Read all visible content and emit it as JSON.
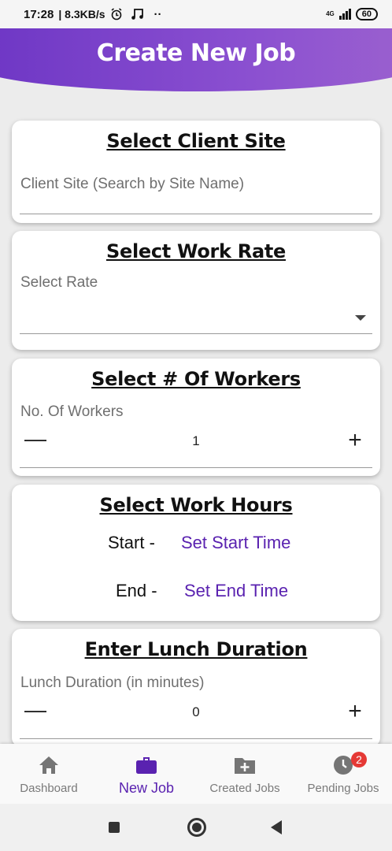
{
  "status_bar": {
    "time": "17:28",
    "speed": "| 8.3KB/s",
    "alarm_icon": "alarm-icon",
    "music_icon": "music-note-icon",
    "dots": "··",
    "network": "4G",
    "battery": "60"
  },
  "header": {
    "title": "Create New Job"
  },
  "client_site": {
    "title": "Select Client Site",
    "placeholder": "Client Site (Search by Site Name)"
  },
  "work_rate": {
    "title": "Select Work Rate",
    "label": "Select Rate"
  },
  "workers": {
    "title": "Select # Of Workers",
    "label": "No. Of Workers",
    "value": "1",
    "minus": "—",
    "plus": "+"
  },
  "work_hours": {
    "title": "Select Work Hours",
    "start_label": "Start -",
    "start_link": "Set Start Time",
    "end_label": "End -",
    "end_link": "Set End Time"
  },
  "lunch": {
    "title": "Enter Lunch Duration",
    "label": "Lunch Duration (in minutes)",
    "value": "0",
    "minus": "—",
    "plus": "+"
  },
  "bottom_nav": {
    "items": [
      {
        "label": "Dashboard",
        "icon": "home-icon"
      },
      {
        "label": "New Job",
        "icon": "briefcase-icon"
      },
      {
        "label": "Created Jobs",
        "icon": "folder-plus-icon"
      },
      {
        "label": "Pending Jobs",
        "icon": "clock-icon",
        "badge": "2"
      }
    ]
  },
  "colors": {
    "accent": "#5a22b0",
    "header_start": "#6c35c4",
    "header_end": "#9c62cf",
    "badge": "#e53935"
  }
}
